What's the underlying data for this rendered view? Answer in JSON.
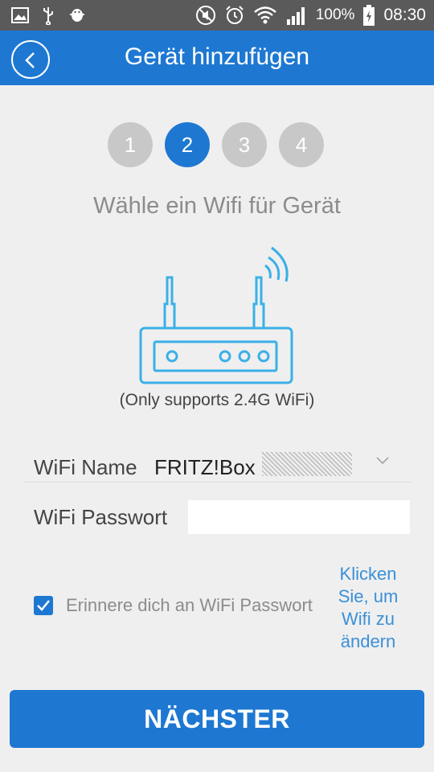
{
  "status_bar": {
    "left_icons": [
      "image-icon",
      "usb-icon",
      "android-debug-icon"
    ],
    "right_icons": [
      "no-sound-icon",
      "alarm-icon",
      "wifi-icon",
      "signal-icon",
      "battery-charging-icon"
    ],
    "battery": "100%",
    "time": "08:30"
  },
  "app_bar": {
    "title": "Gerät hinzufügen",
    "back_icon": "back-icon"
  },
  "steps": [
    "1",
    "2",
    "3",
    "4"
  ],
  "active_step": 2,
  "instruction": "Wähle ein Wifi für Gerät",
  "router_icon": "router-icon",
  "support_note": "(Only supports 2.4G WiFi)",
  "form": {
    "wifi_name_label": "WiFi Name",
    "wifi_name_value": "FRITZ!Box",
    "password_label": "WiFi Passwort",
    "password_value": "",
    "remember_label": "Erinnere dich an WiFi Passwort",
    "remember_checked": true,
    "change_link": "Klicken Sie, um Wifi zu ändern"
  },
  "next_button": "NÄCHSTER",
  "colors": {
    "primary": "#1e78d2",
    "status_bar": "#5a5a5a",
    "inactive_step": "#c8c8c8",
    "link": "#3a90d8",
    "router": "#3ab0e8"
  }
}
